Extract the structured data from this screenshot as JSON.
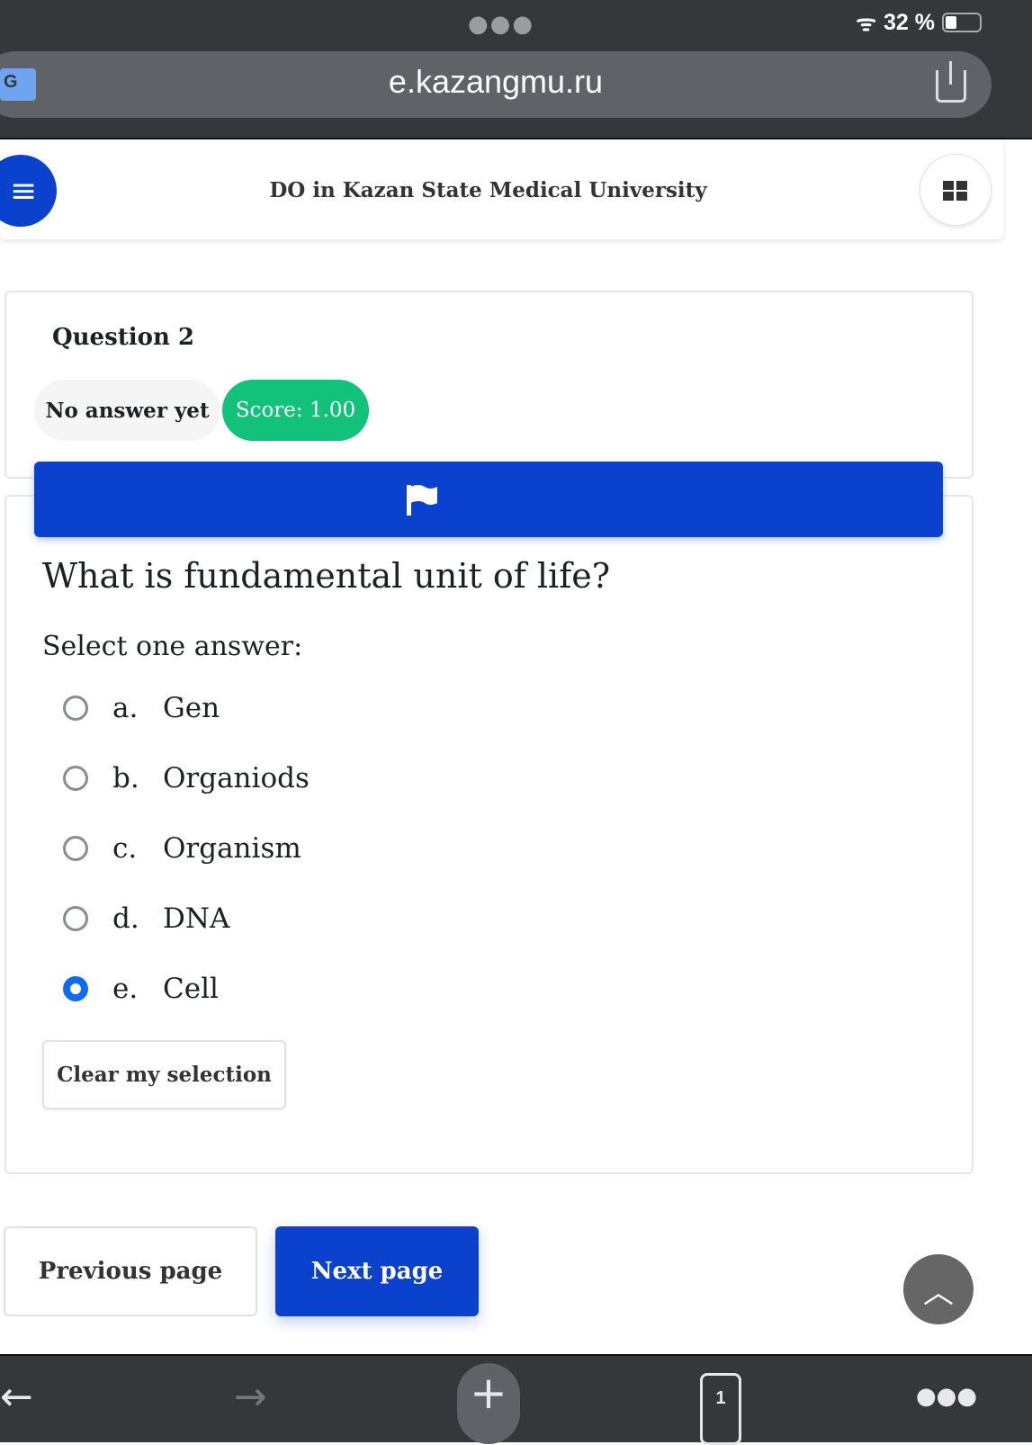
{
  "browser": {
    "url": "e.kazangmu.ru",
    "battery": "32 %",
    "tab_count": "1"
  },
  "header": {
    "site_name": "DO in Kazan State Medical University"
  },
  "question": {
    "number_label": "Question 2",
    "state": "No answer yet",
    "score": "Score: 1.00",
    "text": "What is fundamental unit of life?",
    "prompt": "Select one answer:",
    "options": [
      {
        "letter": "a.",
        "text": "Gen",
        "selected": false
      },
      {
        "letter": "b.",
        "text": "Organiods",
        "selected": false
      },
      {
        "letter": "c.",
        "text": "Organism",
        "selected": false
      },
      {
        "letter": "d.",
        "text": "DNA",
        "selected": false
      },
      {
        "letter": "e.",
        "text": "Cell",
        "selected": true
      }
    ],
    "clear_label": "Clear my selection"
  },
  "nav": {
    "previous_label": "Previous page",
    "next_label": "Next page"
  },
  "colors": {
    "primary": "#0a41cd",
    "success": "#13c27a",
    "radio_selected": "#0f6cf2"
  }
}
